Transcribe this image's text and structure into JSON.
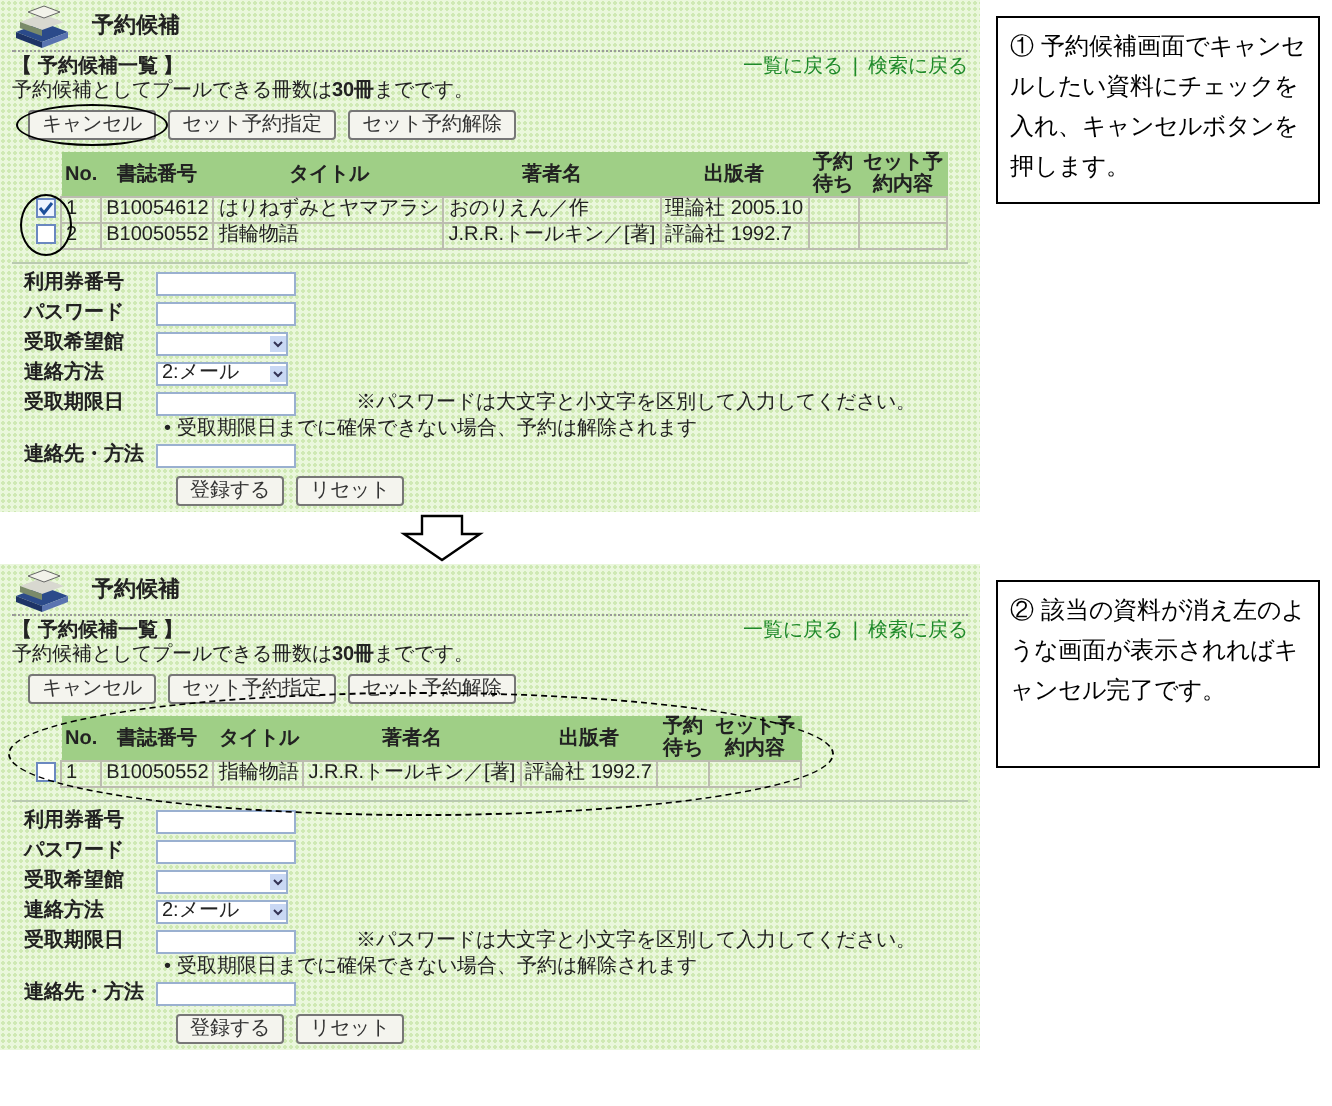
{
  "steps": [
    {
      "page": {
        "title": "予約候補",
        "links": [
          "一覧に戻る",
          "検索に戻る"
        ],
        "link_separator": "|",
        "section_title": "【 予約候補一覧 】",
        "note": "予約候補としてプールできる冊数は**30冊**までです。",
        "buttons": [
          {
            "label": "キャンセル",
            "circled": true
          },
          {
            "label": "セット予約指定",
            "circled": false
          },
          {
            "label": "セット予約解除",
            "circled": false
          }
        ],
        "table": {
          "checkboxes_circled": true,
          "columns": [
            "No.",
            "書誌番号",
            "タイトル",
            "著者名",
            "出版者",
            "予約待ち",
            "セット予約内容"
          ],
          "rows": [
            {
              "checked": true,
              "cells": [
                "1",
                "B10054612",
                "はりねずみとヤマアラシ",
                "おのりえん／作",
                "理論社 2005.10",
                "",
                ""
              ]
            },
            {
              "checked": false,
              "cells": [
                "2",
                "B10050552",
                "指輪物語",
                "J.R.R.トールキン／[著]",
                "評論社 1992.7",
                "",
                ""
              ]
            }
          ]
        },
        "form": {
          "fields": [
            {
              "label": "利用券番号",
              "kind": "text"
            },
            {
              "label": "パスワード",
              "kind": "text"
            },
            {
              "label": "受取希望館",
              "kind": "select"
            },
            {
              "label": "連絡方法",
              "kind": "select",
              "value": "2:メール"
            },
            {
              "label": "受取期限日",
              "kind": "text",
              "hint": "※パスワードは大文字と小文字を区別して入力してください。",
              "note": "• 受取期限日までに確保できない場合、予約は解除されます"
            },
            {
              "label": "連絡先・方法",
              "kind": "text"
            }
          ],
          "buttons": [
            "登録する",
            "リセット"
          ]
        }
      },
      "callout": "① 予約候補画面でキャンセルしたい資料にチェックを入れ、キャンセルボタンを押します。"
    },
    {
      "page": {
        "title": "予約候補",
        "links": [
          "一覧に戻る",
          "検索に戻る"
        ],
        "link_separator": "|",
        "section_title": "【 予約候補一覧 】",
        "note": "予約候補としてプールできる冊数は**30冊**までです。",
        "buttons": [
          {
            "label": "キャンセル",
            "circled": false
          },
          {
            "label": "セット予約指定",
            "circled": false
          },
          {
            "label": "セット予約解除",
            "circled": false
          }
        ],
        "table": {
          "table_circled": true,
          "columns": [
            "No.",
            "書誌番号",
            "タイトル",
            "著者名",
            "出版者",
            "予約待ち",
            "セット予約内容"
          ],
          "rows": [
            {
              "checked": false,
              "cells": [
                "1",
                "B10050552",
                "指輪物語",
                "J.R.R.トールキン／[著]",
                "評論社 1992.7",
                "",
                ""
              ]
            }
          ]
        },
        "form": {
          "fields": [
            {
              "label": "利用券番号",
              "kind": "text"
            },
            {
              "label": "パスワード",
              "kind": "text"
            },
            {
              "label": "受取希望館",
              "kind": "select"
            },
            {
              "label": "連絡方法",
              "kind": "select",
              "value": "2:メール"
            },
            {
              "label": "受取期限日",
              "kind": "text",
              "hint": "※パスワードは大文字と小文字を区別して入力してください。",
              "note": "• 受取期限日までに確保できない場合、予約は解除されます"
            },
            {
              "label": "連絡先・方法",
              "kind": "text"
            }
          ],
          "buttons": [
            "登録する",
            "リセット"
          ]
        }
      },
      "callout": "② 該当の資料が消え左のような画面が表示されればキャンセル完了です。"
    }
  ]
}
